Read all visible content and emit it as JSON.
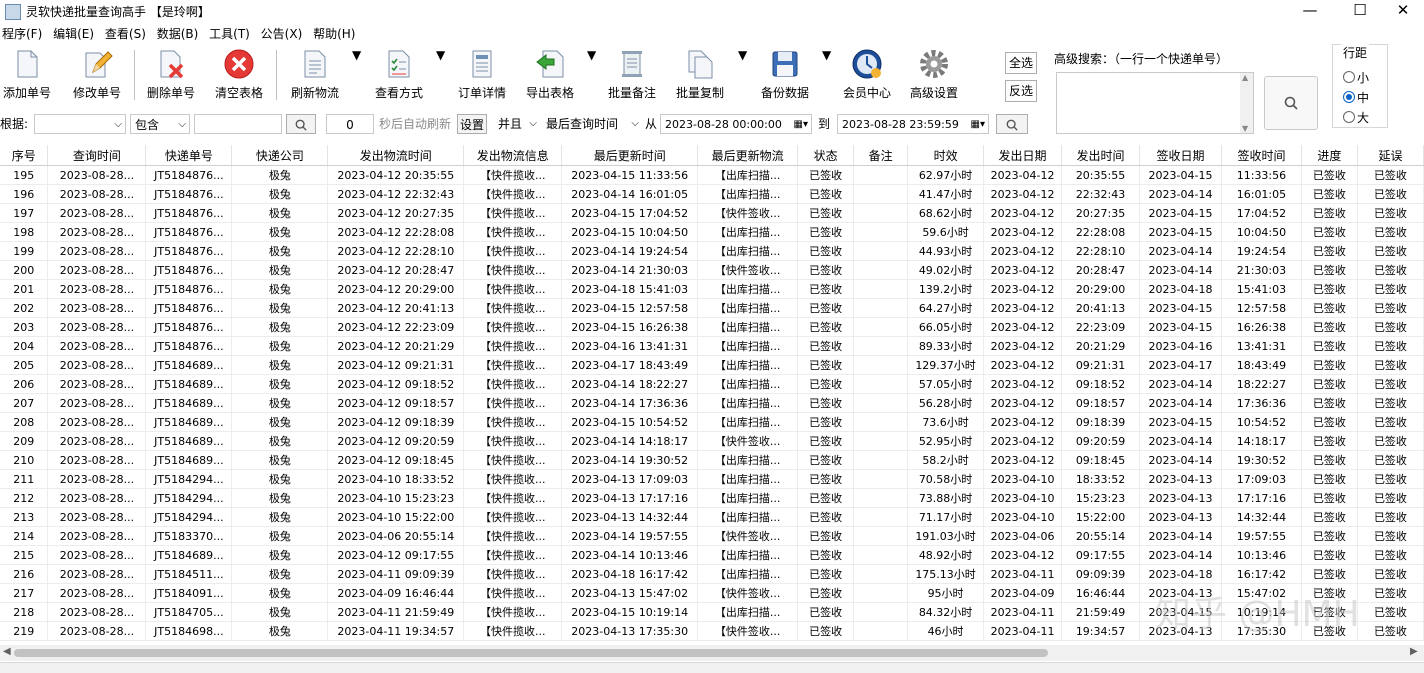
{
  "window": {
    "title": "灵软快递批量查询高手 【是玲啊】",
    "minimize": "—",
    "maximize": "☐",
    "close": "✕"
  },
  "menu": [
    "程序(F)",
    "编辑(E)",
    "查看(S)",
    "数据(B)",
    "工具(T)",
    "公告(X)",
    "帮助(H)"
  ],
  "toolbar": [
    {
      "label": "添加单号",
      "icon": "add-document-icon"
    },
    {
      "label": "修改单号",
      "icon": "edit-pencil-icon"
    },
    {
      "label": "删除单号",
      "icon": "delete-document-icon"
    },
    {
      "label": "清空表格",
      "icon": "clear-red-x-icon"
    },
    {
      "label": "刷新物流",
      "icon": "refresh-document-icon"
    },
    {
      "label": "查看方式",
      "icon": "view-mode-icon"
    },
    {
      "label": "订单详情",
      "icon": "order-detail-icon"
    },
    {
      "label": "导出表格",
      "icon": "export-arrow-icon"
    },
    {
      "label": "批量备注",
      "icon": "scroll-note-icon"
    },
    {
      "label": "批量复制",
      "icon": "copy-documents-icon"
    },
    {
      "label": "备份数据",
      "icon": "floppy-disk-icon"
    },
    {
      "label": "会员中心",
      "icon": "clock-globe-icon"
    },
    {
      "label": "高级设置",
      "icon": "gear-icon"
    }
  ],
  "side_buttons": {
    "select_all": "全选",
    "invert": "反选"
  },
  "advanced_search": {
    "label": "高级搜索：（一行一个快递单号）",
    "value": ""
  },
  "line_spacing": {
    "title": "行距",
    "options": [
      "小",
      "中",
      "大"
    ],
    "selected": "中"
  },
  "filter": {
    "by_label": "根据:",
    "field_value": "",
    "match_mode": "包含",
    "keyword": "",
    "refresh_seconds": "0",
    "auto_refresh_label": "秒后自动刷新",
    "settings_btn": "设置",
    "logic": "并且",
    "time_field": "最后查询时间",
    "from_label": "从",
    "from_value": "2023-08-28 00:00:00",
    "to_label": "到",
    "to_value": "2023-08-28 23:59:59"
  },
  "table": {
    "columns": [
      "序号",
      "查询时间",
      "快递单号",
      "快递公司",
      "发出物流时间",
      "发出物流信息",
      "最后更新时间",
      "最后更新物流",
      "状态",
      "备注",
      "时效",
      "发出日期",
      "发出时间",
      "签收日期",
      "签收时间",
      "进度",
      "延误"
    ],
    "rows": [
      [
        "195",
        "2023-08-28...",
        "JT5184876...",
        "极兔",
        "2023-04-12 20:35:55",
        "【快件揽收...",
        "2023-04-15 11:33:56",
        "【出库扫描...",
        "已签收",
        "",
        "62.97小时",
        "2023-04-12",
        "20:35:55",
        "2023-04-15",
        "11:33:56",
        "已签收",
        "已签收"
      ],
      [
        "196",
        "2023-08-28...",
        "JT5184876...",
        "极兔",
        "2023-04-12 22:32:43",
        "【快件揽收...",
        "2023-04-14 16:01:05",
        "【出库扫描...",
        "已签收",
        "",
        "41.47小时",
        "2023-04-12",
        "22:32:43",
        "2023-04-14",
        "16:01:05",
        "已签收",
        "已签收"
      ],
      [
        "197",
        "2023-08-28...",
        "JT5184876...",
        "极兔",
        "2023-04-12 20:27:35",
        "【快件揽收...",
        "2023-04-15 17:04:52",
        "【快件签收...",
        "已签收",
        "",
        "68.62小时",
        "2023-04-12",
        "20:27:35",
        "2023-04-15",
        "17:04:52",
        "已签收",
        "已签收"
      ],
      [
        "198",
        "2023-08-28...",
        "JT5184876...",
        "极兔",
        "2023-04-12 22:28:08",
        "【快件揽收...",
        "2023-04-15 10:04:50",
        "【出库扫描...",
        "已签收",
        "",
        "59.6小时",
        "2023-04-12",
        "22:28:08",
        "2023-04-15",
        "10:04:50",
        "已签收",
        "已签收"
      ],
      [
        "199",
        "2023-08-28...",
        "JT5184876...",
        "极兔",
        "2023-04-12 22:28:10",
        "【快件揽收...",
        "2023-04-14 19:24:54",
        "【出库扫描...",
        "已签收",
        "",
        "44.93小时",
        "2023-04-12",
        "22:28:10",
        "2023-04-14",
        "19:24:54",
        "已签收",
        "已签收"
      ],
      [
        "200",
        "2023-08-28...",
        "JT5184876...",
        "极兔",
        "2023-04-12 20:28:47",
        "【快件揽收...",
        "2023-04-14 21:30:03",
        "【快件签收...",
        "已签收",
        "",
        "49.02小时",
        "2023-04-12",
        "20:28:47",
        "2023-04-14",
        "21:30:03",
        "已签收",
        "已签收"
      ],
      [
        "201",
        "2023-08-28...",
        "JT5184876...",
        "极兔",
        "2023-04-12 20:29:00",
        "【快件揽收...",
        "2023-04-18 15:41:03",
        "【出库扫描...",
        "已签收",
        "",
        "139.2小时",
        "2023-04-12",
        "20:29:00",
        "2023-04-18",
        "15:41:03",
        "已签收",
        "已签收"
      ],
      [
        "202",
        "2023-08-28...",
        "JT5184876...",
        "极兔",
        "2023-04-12 20:41:13",
        "【快件揽收...",
        "2023-04-15 12:57:58",
        "【出库扫描...",
        "已签收",
        "",
        "64.27小时",
        "2023-04-12",
        "20:41:13",
        "2023-04-15",
        "12:57:58",
        "已签收",
        "已签收"
      ],
      [
        "203",
        "2023-08-28...",
        "JT5184876...",
        "极兔",
        "2023-04-12 22:23:09",
        "【快件揽收...",
        "2023-04-15 16:26:38",
        "【出库扫描...",
        "已签收",
        "",
        "66.05小时",
        "2023-04-12",
        "22:23:09",
        "2023-04-15",
        "16:26:38",
        "已签收",
        "已签收"
      ],
      [
        "204",
        "2023-08-28...",
        "JT5184876...",
        "极兔",
        "2023-04-12 20:21:29",
        "【快件揽收...",
        "2023-04-16 13:41:31",
        "【出库扫描...",
        "已签收",
        "",
        "89.33小时",
        "2023-04-12",
        "20:21:29",
        "2023-04-16",
        "13:41:31",
        "已签收",
        "已签收"
      ],
      [
        "205",
        "2023-08-28...",
        "JT5184689...",
        "极兔",
        "2023-04-12 09:21:31",
        "【快件揽收...",
        "2023-04-17 18:43:49",
        "【出库扫描...",
        "已签收",
        "",
        "129.37小时",
        "2023-04-12",
        "09:21:31",
        "2023-04-17",
        "18:43:49",
        "已签收",
        "已签收"
      ],
      [
        "206",
        "2023-08-28...",
        "JT5184689...",
        "极兔",
        "2023-04-12 09:18:52",
        "【快件揽收...",
        "2023-04-14 18:22:27",
        "【出库扫描...",
        "已签收",
        "",
        "57.05小时",
        "2023-04-12",
        "09:18:52",
        "2023-04-14",
        "18:22:27",
        "已签收",
        "已签收"
      ],
      [
        "207",
        "2023-08-28...",
        "JT5184689...",
        "极兔",
        "2023-04-12 09:18:57",
        "【快件揽收...",
        "2023-04-14 17:36:36",
        "【出库扫描...",
        "已签收",
        "",
        "56.28小时",
        "2023-04-12",
        "09:18:57",
        "2023-04-14",
        "17:36:36",
        "已签收",
        "已签收"
      ],
      [
        "208",
        "2023-08-28...",
        "JT5184689...",
        "极兔",
        "2023-04-12 09:18:39",
        "【快件揽收...",
        "2023-04-15 10:54:52",
        "【出库扫描...",
        "已签收",
        "",
        "73.6小时",
        "2023-04-12",
        "09:18:39",
        "2023-04-15",
        "10:54:52",
        "已签收",
        "已签收"
      ],
      [
        "209",
        "2023-08-28...",
        "JT5184689...",
        "极兔",
        "2023-04-12 09:20:59",
        "【快件揽收...",
        "2023-04-14 14:18:17",
        "【快件签收...",
        "已签收",
        "",
        "52.95小时",
        "2023-04-12",
        "09:20:59",
        "2023-04-14",
        "14:18:17",
        "已签收",
        "已签收"
      ],
      [
        "210",
        "2023-08-28...",
        "JT5184689...",
        "极兔",
        "2023-04-12 09:18:45",
        "【快件揽收...",
        "2023-04-14 19:30:52",
        "【出库扫描...",
        "已签收",
        "",
        "58.2小时",
        "2023-04-12",
        "09:18:45",
        "2023-04-14",
        "19:30:52",
        "已签收",
        "已签收"
      ],
      [
        "211",
        "2023-08-28...",
        "JT5184294...",
        "极兔",
        "2023-04-10 18:33:52",
        "【快件揽收...",
        "2023-04-13 17:09:03",
        "【出库扫描...",
        "已签收",
        "",
        "70.58小时",
        "2023-04-10",
        "18:33:52",
        "2023-04-13",
        "17:09:03",
        "已签收",
        "已签收"
      ],
      [
        "212",
        "2023-08-28...",
        "JT5184294...",
        "极兔",
        "2023-04-10 15:23:23",
        "【快件揽收...",
        "2023-04-13 17:17:16",
        "【出库扫描...",
        "已签收",
        "",
        "73.88小时",
        "2023-04-10",
        "15:23:23",
        "2023-04-13",
        "17:17:16",
        "已签收",
        "已签收"
      ],
      [
        "213",
        "2023-08-28...",
        "JT5184294...",
        "极兔",
        "2023-04-10 15:22:00",
        "【快件揽收...",
        "2023-04-13 14:32:44",
        "【出库扫描...",
        "已签收",
        "",
        "71.17小时",
        "2023-04-10",
        "15:22:00",
        "2023-04-13",
        "14:32:44",
        "已签收",
        "已签收"
      ],
      [
        "214",
        "2023-08-28...",
        "JT5183370...",
        "极兔",
        "2023-04-06 20:55:14",
        "【快件揽收...",
        "2023-04-14 19:57:55",
        "【快件签收...",
        "已签收",
        "",
        "191.03小时",
        "2023-04-06",
        "20:55:14",
        "2023-04-14",
        "19:57:55",
        "已签收",
        "已签收"
      ],
      [
        "215",
        "2023-08-28...",
        "JT5184689...",
        "极兔",
        "2023-04-12 09:17:55",
        "【快件揽收...",
        "2023-04-14 10:13:46",
        "【出库扫描...",
        "已签收",
        "",
        "48.92小时",
        "2023-04-12",
        "09:17:55",
        "2023-04-14",
        "10:13:46",
        "已签收",
        "已签收"
      ],
      [
        "216",
        "2023-08-28...",
        "JT5184511...",
        "极兔",
        "2023-04-11 09:09:39",
        "【快件揽收...",
        "2023-04-18 16:17:42",
        "【出库扫描...",
        "已签收",
        "",
        "175.13小时",
        "2023-04-11",
        "09:09:39",
        "2023-04-18",
        "16:17:42",
        "已签收",
        "已签收"
      ],
      [
        "217",
        "2023-08-28...",
        "JT5184091...",
        "极兔",
        "2023-04-09 16:46:44",
        "【快件揽收...",
        "2023-04-13 15:47:02",
        "【快件签收...",
        "已签收",
        "",
        "95小时",
        "2023-04-09",
        "16:46:44",
        "2023-04-13",
        "15:47:02",
        "已签收",
        "已签收"
      ],
      [
        "218",
        "2023-08-28...",
        "JT5184705...",
        "极兔",
        "2023-04-11 21:59:49",
        "【快件揽收...",
        "2023-04-15 10:19:14",
        "【出库扫描...",
        "已签收",
        "",
        "84.32小时",
        "2023-04-11",
        "21:59:49",
        "2023-04-15",
        "10:19:14",
        "已签收",
        "已签收"
      ],
      [
        "219",
        "2023-08-28...",
        "JT5184698...",
        "极兔",
        "2023-04-11 19:34:57",
        "【快件揽收...",
        "2023-04-13 17:35:30",
        "【快件签收...",
        "已签收",
        "",
        "46小时",
        "2023-04-11",
        "19:34:57",
        "2023-04-13",
        "17:35:30",
        "已签收",
        "已签收"
      ]
    ]
  },
  "watermark": "知乎 @HMH",
  "colors": {
    "accent": "#0a64c8",
    "delete_red": "#e53935",
    "grid_line": "#ececec"
  }
}
